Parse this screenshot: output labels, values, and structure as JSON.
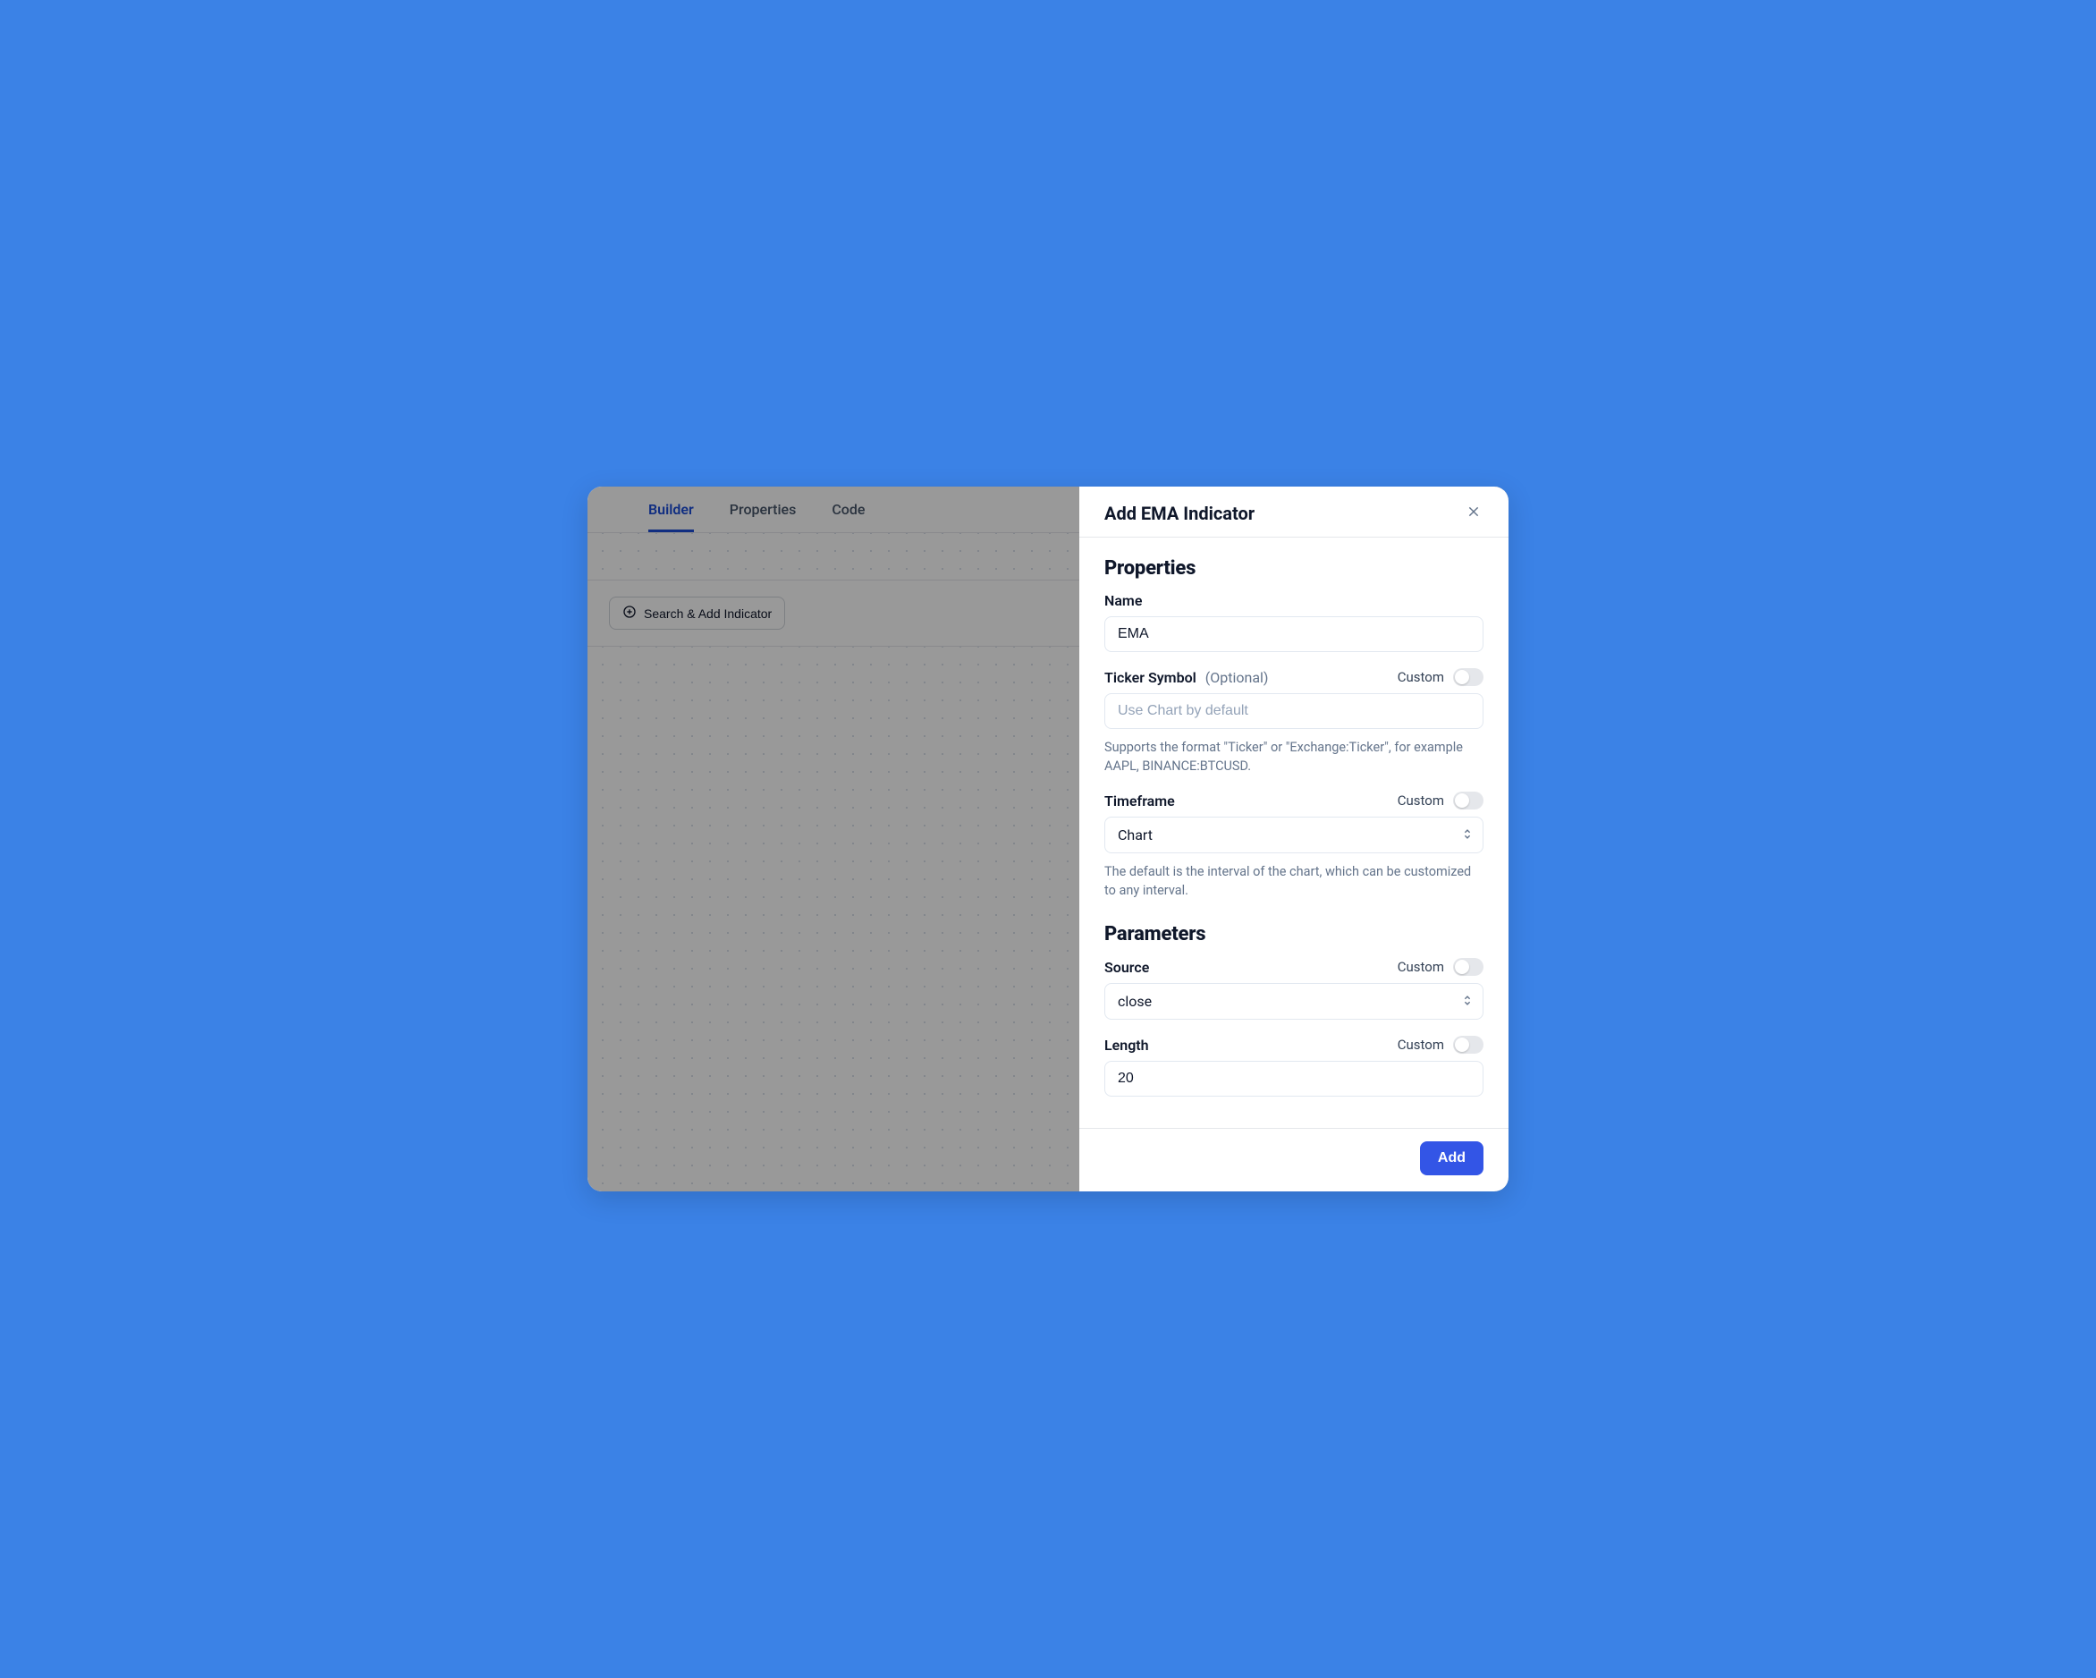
{
  "tabs": {
    "builder": "Builder",
    "properties": "Properties",
    "code": "Code"
  },
  "search_add_label": "Search & Add Indicator",
  "panel": {
    "title": "Add EMA Indicator",
    "sections": {
      "properties": "Properties",
      "parameters": "Parameters"
    },
    "custom_label": "Custom",
    "optional_label": "(Optional)",
    "fields": {
      "name": {
        "label": "Name",
        "value": "EMA"
      },
      "ticker": {
        "label": "Ticker Symbol",
        "placeholder": "Use Chart by default",
        "help": "Supports the format \"Ticker\" or \"Exchange:Ticker\", for example AAPL, BINANCE:BTCUSD."
      },
      "timeframe": {
        "label": "Timeframe",
        "value": "Chart",
        "help": "The default is the interval of the chart, which can be customized to any interval."
      },
      "source": {
        "label": "Source",
        "value": "close"
      },
      "length": {
        "label": "Length",
        "value": "20"
      }
    },
    "add_button": "Add"
  }
}
